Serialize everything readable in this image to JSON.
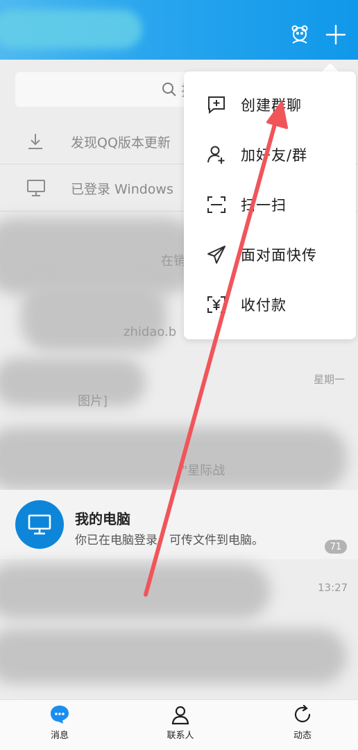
{
  "search": {
    "placeholder_text": "搜"
  },
  "notices": [
    {
      "label": "发现QQ版本更新"
    },
    {
      "label": "已登录 Windows"
    }
  ],
  "chats": {
    "snippet_1": "在销",
    "snippet_2": "zhidao.b",
    "time_1": "星期一",
    "snippet_3": "图片]",
    "snippet_4": "\"星际战",
    "my_pc": {
      "title": "我的电脑",
      "subtitle": "你已在电脑登录，可传文件到电脑。"
    },
    "time_2": "13:27",
    "unread_badge": "71"
  },
  "menu": {
    "items": [
      {
        "label": "创建群聊",
        "icon": "create-group-icon"
      },
      {
        "label": "加好友/群",
        "icon": "add-friend-icon"
      },
      {
        "label": "扫一扫",
        "icon": "scan-icon"
      },
      {
        "label": "面对面快传",
        "icon": "paper-plane-icon"
      },
      {
        "label": "收付款",
        "icon": "payment-icon"
      }
    ]
  },
  "tabs": [
    {
      "label": "消息",
      "icon": "chat-bubble-icon",
      "active": true
    },
    {
      "label": "联系人",
      "icon": "contacts-icon",
      "active": false
    },
    {
      "label": "动态",
      "icon": "refresh-icon",
      "active": false
    }
  ],
  "colors": {
    "accent": "#1098ea",
    "annotation_arrow": "#f0555a",
    "active_tab": "#1a8ef0"
  }
}
